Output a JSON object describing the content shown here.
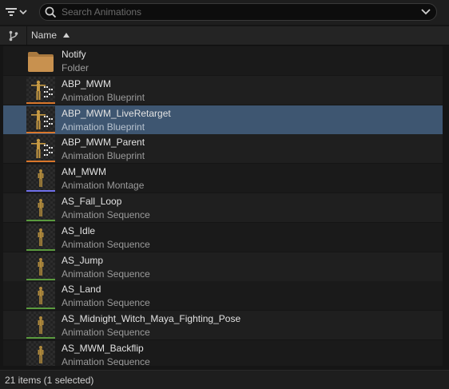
{
  "toolbar": {
    "filter_icon": "filter-icon",
    "filter_dropdown_icon": "chevron-down-icon",
    "search_placeholder": "Search Animations"
  },
  "header": {
    "branch_icon": "source-control-icon",
    "name_label": "Name",
    "sort": "ascending"
  },
  "rows": [
    {
      "name": "Notify",
      "type": "Folder",
      "kind": "folder",
      "selected": false
    },
    {
      "name": "ABP_MWM",
      "type": "Animation Blueprint",
      "kind": "blueprint",
      "selected": false
    },
    {
      "name": "ABP_MWM_LiveRetarget",
      "type": "Animation Blueprint",
      "kind": "blueprint",
      "selected": true
    },
    {
      "name": "ABP_MWM_Parent",
      "type": "Animation Blueprint",
      "kind": "blueprint",
      "selected": false
    },
    {
      "name": "AM_MWM",
      "type": "Animation Montage",
      "kind": "montage",
      "selected": false
    },
    {
      "name": "AS_Fall_Loop",
      "type": "Animation Sequence",
      "kind": "sequence",
      "selected": false
    },
    {
      "name": "AS_Idle",
      "type": "Animation Sequence",
      "kind": "sequence",
      "selected": false
    },
    {
      "name": "AS_Jump",
      "type": "Animation Sequence",
      "kind": "sequence",
      "selected": false
    },
    {
      "name": "AS_Land",
      "type": "Animation Sequence",
      "kind": "sequence",
      "selected": false
    },
    {
      "name": "AS_Midnight_Witch_Maya_Fighting_Pose",
      "type": "Animation Sequence",
      "kind": "sequence",
      "selected": false
    },
    {
      "name": "AS_MWM_Backflip",
      "type": "Animation Sequence",
      "kind": "sequence",
      "selected": false
    }
  ],
  "asset_colors": {
    "blueprint": "#d9762a",
    "montage": "#6f6fe8",
    "sequence": "#5a9a3e",
    "selection": "#3e5671"
  },
  "footer": {
    "status": "21 items (1 selected)"
  }
}
